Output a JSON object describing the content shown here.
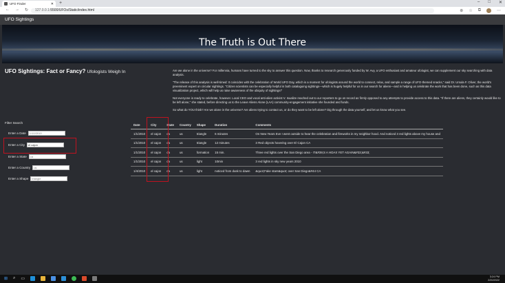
{
  "browser": {
    "tab_title": "UFO Finder",
    "new_tab": "+",
    "url_scheme": "127.0.0.1",
    "url_path": ":5500/UFOs/Static/index.html",
    "window_controls": [
      "–",
      "□",
      "✕"
    ]
  },
  "navbar": {
    "brand": "UFO Sightings"
  },
  "hero": {
    "title": "The Truth is Out There"
  },
  "intro": {
    "title": "UFO Sightings: Fact or Fancy?",
    "subtitle": "Ufologists Weigh In"
  },
  "article": {
    "p1": "Are we alone in the universe? For millennia, humans have turned to the sky to answer this question. Now, thanks to research generously funded by W. Avy, a UFO enthusiast and amateur ufologist, we can supplement our sky searching with data analysis.",
    "p2": "\"The release of this analysis is well-timed: It coincides with the celebration of World UFO Day, which is a moment for ufologists around the world to connect, relax, and sample a range of UFO-themed snacks,\" said Dr. Ursula F. Oliver, the world's preeminent expert on circular sightings. \"Citizen scientists can be especially helpful in both cataloguing sightings—which is hugely helpful for us in our search for aliens—and in helping us celebrate the work that has been done, such as this data visualization project, which will help us raise awareness of the ubiquity of sightings!\"",
    "p3": "Not everyone is ready to celebrate, however. Local CEO and vocal anti-alien activist V. Isualize reached out to our reporters to go on record as firmly opposed to any attempts to provide access to this data. \"If there are aliens, they certainly would like to be left alone,\" she stated, before directing us to the Leave Aliens Alone (LAA) community-engagement initiative she founded and funds.",
    "p4": "So what do YOU think? Are we alone in the universe? Are aliens trying to contact us, or do they want to be left alone? Dig through the data yourself, and let us know what you see."
  },
  "filters": {
    "title": "Filter Search",
    "date": {
      "label": "Enter a Date",
      "placeholder": "1/10/2010"
    },
    "city": {
      "label": "Enter a City",
      "value": "el cajon"
    },
    "state": {
      "label": "Enter a State",
      "placeholder": "ca"
    },
    "country": {
      "label": "Enter a Country",
      "placeholder": "us"
    },
    "shape": {
      "label": "Enter a Shape",
      "placeholder": "triangle"
    }
  },
  "table": {
    "headers": [
      "Date",
      "City",
      "State",
      "Country",
      "Shape",
      "Duration",
      "Comments"
    ],
    "rows": [
      [
        "1/1/2010",
        "el cajon",
        "ca",
        "us",
        "triangle",
        "6 minutes",
        "On New Years Eve I went outside to hear the celebration and fireworks in my neighbor hood. And noticed 3 red lights above my house and"
      ],
      [
        "1/1/2010",
        "el cajon",
        "ca",
        "us",
        "triangle",
        "12 minutes",
        "3 Red objects hovering over El Cajon CA"
      ],
      [
        "1/1/2010",
        "el cajon",
        "ca",
        "us",
        "formation",
        "15 min.",
        "Three red lights over the San Diego area - IT&#39;S A HOAX YET AGAIN&#33;&#33;"
      ],
      [
        "1/1/2010",
        "el cajon",
        "ca",
        "us",
        "light",
        "10min",
        "3 red lights in sky new years 2010"
      ],
      [
        "1/4/2010",
        "el cajon",
        "ca",
        "us",
        "light",
        "noticed from dusk to dawn",
        "&quot;Fake stars&quot; over San Diego&#44 CA"
      ]
    ]
  },
  "taskbar": {
    "time": "3:24 PM",
    "date": "2/20/2022",
    "icons": [
      "windows-icon",
      "search-icon",
      "task-view-icon",
      "edge-icon",
      "file-explorer-icon",
      "store-icon",
      "vscode-icon",
      "chrome-icon",
      "teams-icon",
      "app-icon"
    ]
  },
  "colors": {
    "highlight": "#c1121f",
    "background": "#2a2c31",
    "navbar": "#3a3b3e"
  }
}
